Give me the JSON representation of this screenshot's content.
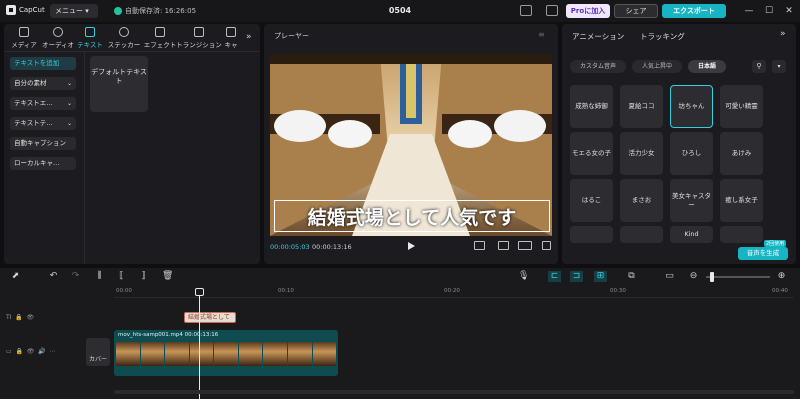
{
  "titlebar": {
    "app_name": "CapCut",
    "menu_label": "メニュー",
    "save_status": "自動保存済: 16:26:05",
    "project_name": "0504",
    "pro_label": "Proに加入",
    "share_label": "シェア",
    "export_label": "エクスポート"
  },
  "left_panel": {
    "tabs": [
      {
        "label": "メディア",
        "icon": "media-icon"
      },
      {
        "label": "オーディオ",
        "icon": "audio-icon"
      },
      {
        "label": "テキスト",
        "icon": "text-icon"
      },
      {
        "label": "ステッカー",
        "icon": "sticker-icon"
      },
      {
        "label": "エフェクト",
        "icon": "effect-icon"
      },
      {
        "label": "トランジション",
        "icon": "transition-icon"
      },
      {
        "label": "キャ",
        "icon": "caption-icon"
      }
    ],
    "side_items": [
      "テキストを追加",
      "自分の素材",
      "テキストエ…",
      "テキストテ…",
      "自動キャプション",
      "ローカルキャ…"
    ],
    "template_label": "デフォルトテキスト"
  },
  "player": {
    "title": "プレーヤー",
    "overlay_text": "結婚式場として人気です",
    "current_time": "00:00:05:03",
    "total_time": "00:00:13:16"
  },
  "right_panel": {
    "tabs": [
      "アニメーション",
      "トラッキング"
    ],
    "chips": [
      "カスタム音声",
      "人気上昇中",
      "日本語"
    ],
    "voices": [
      "成熟な姉御",
      "夏絵ココ",
      "坊ちゃん",
      "可愛い精霊",
      "モエる女の子",
      "活力少女",
      "ひろし",
      "あけみ",
      "はるこ",
      "まさお",
      "美女キャスター",
      "癒し系女子",
      "",
      "",
      "Kind",
      ""
    ],
    "generate_label": "音声を生成",
    "generate_badge": "2回使用"
  },
  "timeline": {
    "ticks": [
      "00:00",
      "00:10",
      "00:20",
      "00:30",
      "00:40"
    ],
    "text_clip": "結婚式場として",
    "video_clip_label": "mov_hts-samp001.mp4  00:00:13:16",
    "cover_label": "カバー"
  },
  "colors": {
    "accent": "#33d1e0",
    "export": "#17b5c4",
    "clip": "#0f4c52"
  }
}
